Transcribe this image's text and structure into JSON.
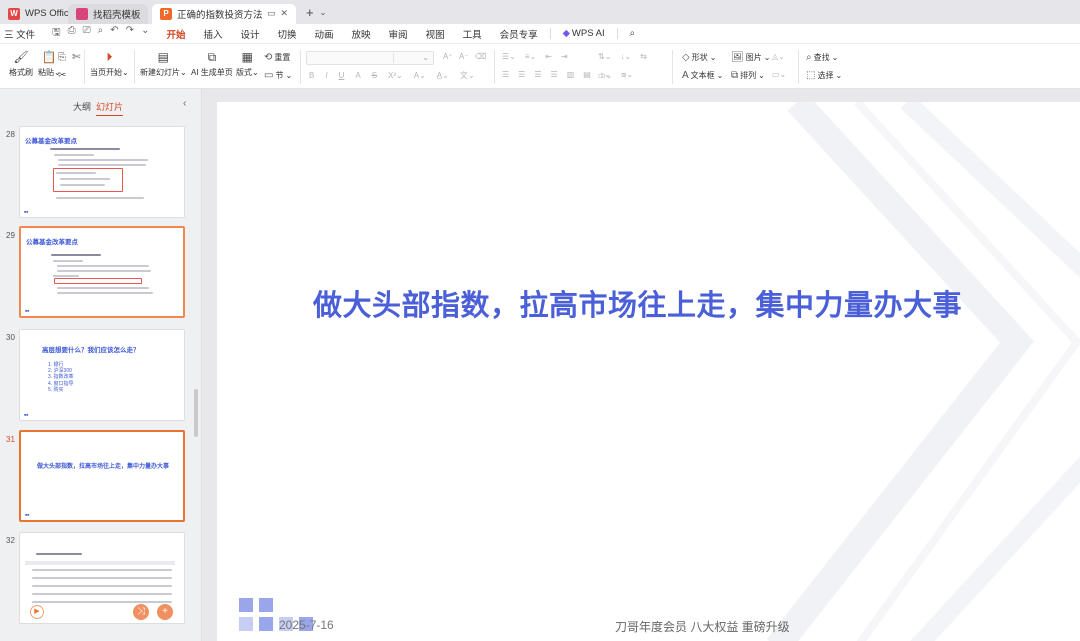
{
  "tabs": [
    {
      "label": "WPS Office",
      "icon": "wps-logo-icon"
    },
    {
      "label": "找稻壳模板",
      "icon": "docer-icon"
    },
    {
      "label": "正确的指数投资方法论 刀哥",
      "icon": "presentation-icon"
    }
  ],
  "menu": {
    "file": "三 文件",
    "items": [
      "开始",
      "插入",
      "设计",
      "切换",
      "动画",
      "放映",
      "审阅",
      "视图",
      "工具",
      "会员专享"
    ],
    "active": "开始",
    "ai": "WPS AI"
  },
  "ribbon": {
    "format_painter": "格式刷",
    "paste": "粘贴",
    "from_current": "当页开始",
    "new_slide": "新建幻灯片",
    "ai_single": "AI 生成单页",
    "layout": "版式",
    "reset": "重置",
    "section": "节",
    "shape": "形状",
    "picture": "图片",
    "textbox": "文本框",
    "arrange": "排列",
    "find": "查找",
    "select": "选择"
  },
  "panel": {
    "tab_outline": "大纲",
    "tab_slides": "幻灯片",
    "active_tab": "幻灯片"
  },
  "thumbnails": [
    {
      "num": "28",
      "title": "公募基金改革要点"
    },
    {
      "num": "29",
      "title": "公募基金改革要点"
    },
    {
      "num": "30",
      "title": "高层想要什么？我们应该怎么走？",
      "items": [
        "1. 银行",
        "2. 沪深300",
        "3. 指数改革",
        "4. 窗口指导",
        "5. 购买"
      ]
    },
    {
      "num": "31",
      "title": "做大头部指数，拉高市场往上走，集中力量办大事"
    },
    {
      "num": "32",
      "title": ""
    }
  ],
  "current_slide": {
    "headline": "做大头部指数，拉高市场往上走，集中力量办大事",
    "date": "2025-7-16",
    "slogan": "刀哥年度会员 八大权益 重磅升级"
  },
  "colors": {
    "accent": "#d24726",
    "headline": "#4a5fd8",
    "selection": "#e8752f"
  }
}
